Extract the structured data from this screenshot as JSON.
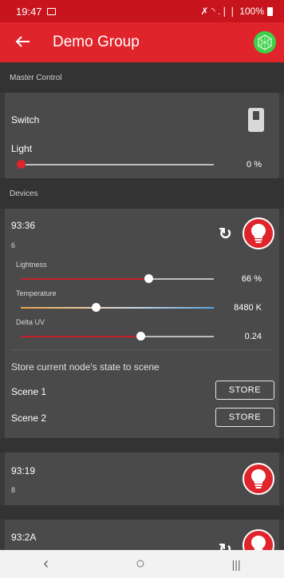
{
  "status_bar": {
    "time": "19:47",
    "signal_text": "✗ ◝ .❘❘",
    "battery": "100%"
  },
  "app_bar": {
    "back_icon": "arrow-left-icon",
    "title": "Demo Group",
    "logo_icon": "mesh-logo-icon"
  },
  "master_control": {
    "header": "Master Control",
    "switch_label": "Switch",
    "switch_on": false,
    "light_label": "Light",
    "light_value": "0 %",
    "light_level": 0
  },
  "devices": {
    "header": "Devices",
    "items": [
      {
        "name": "93:36",
        "id": "6",
        "lightness_label": "Lightness",
        "lightness_value": "66 %",
        "lightness_level": 0.66,
        "temperature_label": "Temperature",
        "temperature_value": "8480 K",
        "temperature_level": 0.39,
        "delta_uv_label": "Delta UV",
        "delta_uv_value": "0.24",
        "delta_uv_level": 0.62,
        "scene_prompt": "Store current node's state to scene",
        "scenes": [
          {
            "name": "Scene 1",
            "button": "STORE"
          },
          {
            "name": "Scene 2",
            "button": "STORE"
          }
        ]
      },
      {
        "name": "93:19",
        "id": "8"
      },
      {
        "name": "93:2A"
      }
    ]
  },
  "nav_bar": {
    "back": "‹",
    "home": "○",
    "recents": "|||"
  },
  "colors": {
    "primary": "#e0242b",
    "status": "#c8151d",
    "card": "#4a4a4a",
    "background": "#333333"
  }
}
